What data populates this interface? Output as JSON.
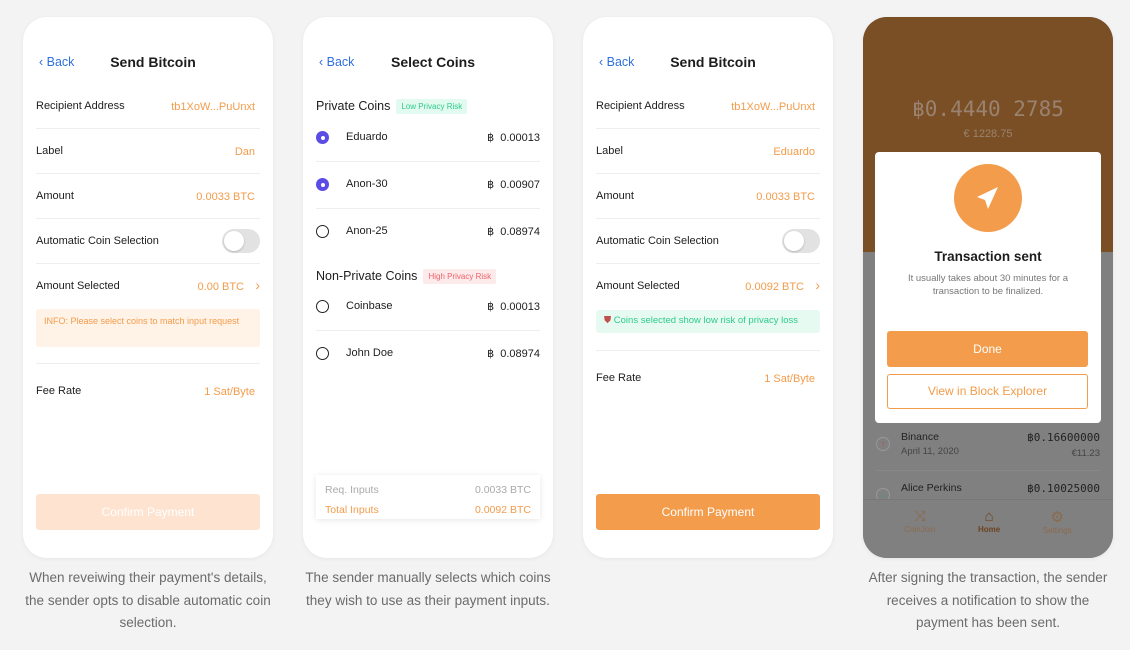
{
  "screen1": {
    "back": "Back",
    "title": "Send Bitcoin",
    "rows": [
      {
        "label": "Recipient Address",
        "value": "tb1XoW...PuUnxt"
      },
      {
        "label": "Label",
        "value": "Dan"
      },
      {
        "label": "Amount",
        "value": "0.0033 BTC"
      },
      {
        "label": "Automatic Coin Selection",
        "toggle": false
      },
      {
        "label": "Amount Selected",
        "value": "0.00 BTC"
      }
    ],
    "info": "INFO: Please select coins to match input request",
    "fee_label": "Fee Rate",
    "fee_value": "1 Sat/Byte",
    "confirm": "Confirm Payment",
    "confirm_enabled": false,
    "caption": "When reveiwing their payment's details, the sender opts to disable automatic coin selection."
  },
  "screen2": {
    "back": "Back",
    "title": "Select Coins",
    "private": {
      "title": "Private Coins",
      "badge": "Low Privacy Risk",
      "coins": [
        {
          "name": "Eduardo",
          "amount": "0.00013",
          "selected": true
        },
        {
          "name": "Anon-30",
          "amount": "0.00907",
          "selected": true
        },
        {
          "name": "Anon-25",
          "amount": "0.08974",
          "selected": false
        }
      ]
    },
    "nonprivate": {
      "title": "Non-Private Coins",
      "badge": "High Privacy Risk",
      "coins": [
        {
          "name": "Coinbase",
          "amount": "0.00013",
          "selected": false
        },
        {
          "name": "John Doe",
          "amount": "0.08974",
          "selected": false
        }
      ]
    },
    "btc_symbol": "฿",
    "summary": {
      "req_label": "Req. Inputs",
      "req_value": "0.0033 BTC",
      "total_label": "Total Inputs",
      "total_value": "0.0092 BTC"
    },
    "caption": "The sender manually selects which coins they wish to use as their payment inputs."
  },
  "screen3": {
    "back": "Back",
    "title": "Send Bitcoin",
    "rows": [
      {
        "label": "Recipient Address",
        "value": "tb1XoW...PuUnxt"
      },
      {
        "label": "Label",
        "value": "Eduardo"
      },
      {
        "label": "Amount",
        "value": "0.0033 BTC"
      },
      {
        "label": "Automatic Coin Selection",
        "toggle": false
      },
      {
        "label": "Amount Selected",
        "value": "0.0092 BTC"
      }
    ],
    "notice": "Coins selected show low risk of privacy loss",
    "fee_label": "Fee Rate",
    "fee_value": "1 Sat/Byte",
    "confirm": "Confirm Payment",
    "confirm_enabled": true
  },
  "screen4": {
    "balance": "฿0.4440 2785",
    "fiat": "€ 1228.75",
    "modal": {
      "title": "Transaction sent",
      "text": "It usually takes about 30 minutes for a transaction to be finalized.",
      "done": "Done",
      "explorer": "View in Block Explorer"
    },
    "transactions": [
      {
        "name": "Binance",
        "date": "April 11, 2020",
        "amount": "฿0.16600000",
        "fiat": "€11.23",
        "direction": "out"
      },
      {
        "name": "Alice Perkins",
        "amount": "฿0.10025000",
        "direction": "in"
      }
    ],
    "tabs": [
      {
        "label": "CoinJoin",
        "icon": "shuffle-icon"
      },
      {
        "label": "Home",
        "icon": "home-icon",
        "active": true
      },
      {
        "label": "Settings",
        "icon": "gear-icon"
      }
    ],
    "caption": "After signing the transaction, the sender receives a notification to show the payment has been sent."
  },
  "colors": {
    "accent": "#f39c4b",
    "brown": "#7a4f25",
    "radio": "#5b4ce6",
    "green": "#2ecc8a",
    "red": "#f0646e"
  }
}
